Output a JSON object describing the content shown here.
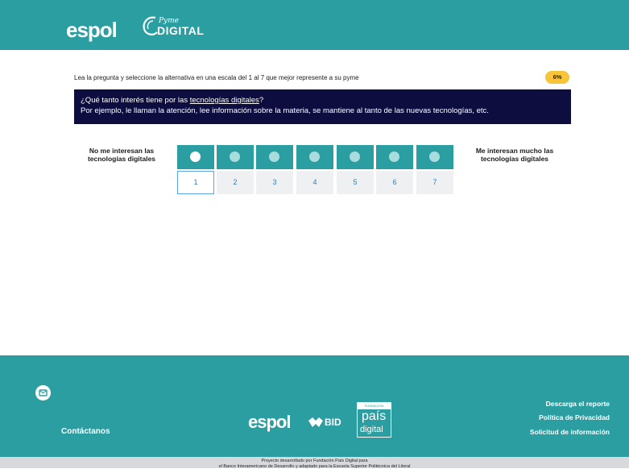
{
  "header": {
    "logo_espol": "espol",
    "logo_pyme": "Pyme",
    "logo_digital": "DIGITAL"
  },
  "instruction": "Lea la pregunta y seleccione la alternativa en una escala del 1 al 7 que mejor represente a su pyme",
  "progress": {
    "label": "6%",
    "value": 6
  },
  "question": {
    "prefix": "¿Qué tanto interés tiene por las ",
    "term": "tecnologías digitales",
    "suffix": "?",
    "example": "Por ejemplo, le llaman la atención, lee información sobre la materia, se mantiene al tanto de las nuevas tecnologías, etc."
  },
  "scale": {
    "left_label": "No me interesan las tecnologías digitales",
    "right_label": "Me interesan mucho las tecnologías digitales",
    "options": [
      "1",
      "2",
      "3",
      "4",
      "5",
      "6",
      "7"
    ],
    "selected": "1"
  },
  "footer": {
    "contact": "Contáctanos",
    "logo_espol": "espol",
    "logo_bid": "BID",
    "logo_pais_fundacion": "FUNDACIÓN",
    "logo_pais_1": "país",
    "logo_pais_2": "digital",
    "links": [
      "Descarga el reporte",
      "Política de Privacidad",
      "Solicitud de información"
    ]
  },
  "credits": {
    "line1": "Proyecto desarrollado por Fundación País Digital para",
    "line2": "el Banco Interamericano de Desarrollo y adaptado para la Escuela Superior Politécnica del Litoral"
  },
  "colors": {
    "teal": "#2b9ea2",
    "navy": "#0d0d3f",
    "badge": "#f7c43a",
    "number_blue": "#2b7fc2"
  }
}
